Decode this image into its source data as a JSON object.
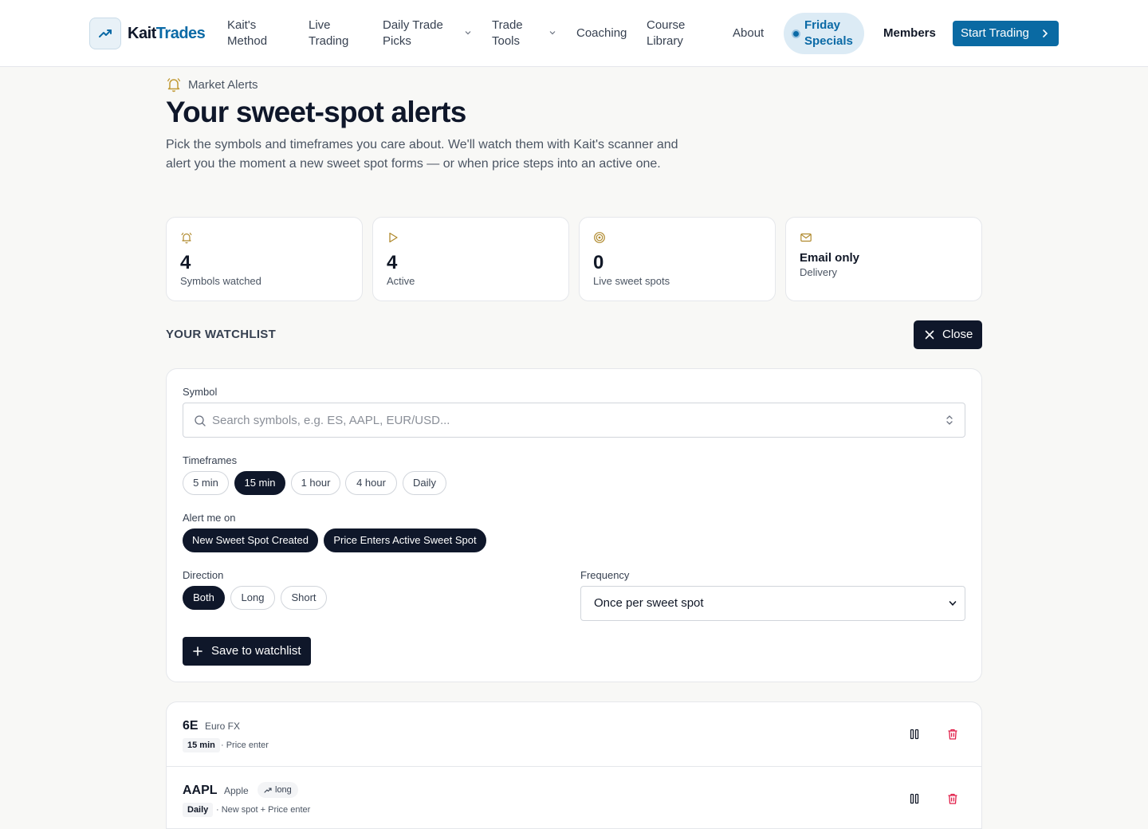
{
  "brand": {
    "part1": "Kait",
    "part2": "Trades"
  },
  "nav": {
    "items": [
      {
        "label": "Kait's Method"
      },
      {
        "label": "Live Trading"
      },
      {
        "label": "Daily Trade Picks"
      },
      {
        "label": "Trade Tools"
      },
      {
        "label": "Coaching"
      },
      {
        "label": "Course Library"
      },
      {
        "label": "About"
      }
    ],
    "friday": "Friday Specials",
    "members": "Members",
    "cta": "Start Trading"
  },
  "header": {
    "kicker": "Market Alerts",
    "title": "Your sweet-spot alerts",
    "subtitle": "Pick the symbols and timeframes you care about. We'll watch them with Kait's scanner and alert you the moment a new sweet spot forms — or when price steps into an active one."
  },
  "stats": [
    {
      "icon": "bell-icon",
      "value": "4",
      "label": "Symbols watched"
    },
    {
      "icon": "play-icon",
      "value": "4",
      "label": "Active"
    },
    {
      "icon": "target-icon",
      "value": "0",
      "label": "Live sweet spots"
    },
    {
      "icon": "mail-icon",
      "value": "Email only",
      "label": "Delivery"
    }
  ],
  "watchlist": {
    "heading": "YOUR WATCHLIST",
    "close_label": "Close"
  },
  "form": {
    "symbol_label": "Symbol",
    "symbol_placeholder": "Search symbols, e.g. ES, AAPL, EUR/USD...",
    "timeframes_label": "Timeframes",
    "timeframes": [
      {
        "label": "5 min",
        "selected": false
      },
      {
        "label": "15 min",
        "selected": true
      },
      {
        "label": "1 hour",
        "selected": false
      },
      {
        "label": "4 hour",
        "selected": false
      },
      {
        "label": "Daily",
        "selected": false
      }
    ],
    "alert_label": "Alert me on",
    "alerts": [
      {
        "label": "New Sweet Spot Created",
        "selected": true
      },
      {
        "label": "Price Enters Active Sweet Spot",
        "selected": true
      }
    ],
    "direction_label": "Direction",
    "directions": [
      {
        "label": "Both",
        "selected": true
      },
      {
        "label": "Long",
        "selected": false
      },
      {
        "label": "Short",
        "selected": false
      }
    ],
    "frequency_label": "Frequency",
    "frequency_value": "Once per sweet spot",
    "save_label": "Save to watchlist"
  },
  "rows": [
    {
      "symbol": "6E",
      "name": "Euro FX",
      "timeframe": "15 min",
      "meta": "· Price enter"
    },
    {
      "symbol": "AAPL",
      "name": "Apple",
      "direction": "long",
      "timeframe": "Daily",
      "meta": "· New spot + Price enter"
    }
  ],
  "colors": {
    "brand_blue": "#0b6aa6",
    "dark": "#0f172a",
    "gold_icon": "#b08a2e",
    "danger": "#e11d48"
  }
}
